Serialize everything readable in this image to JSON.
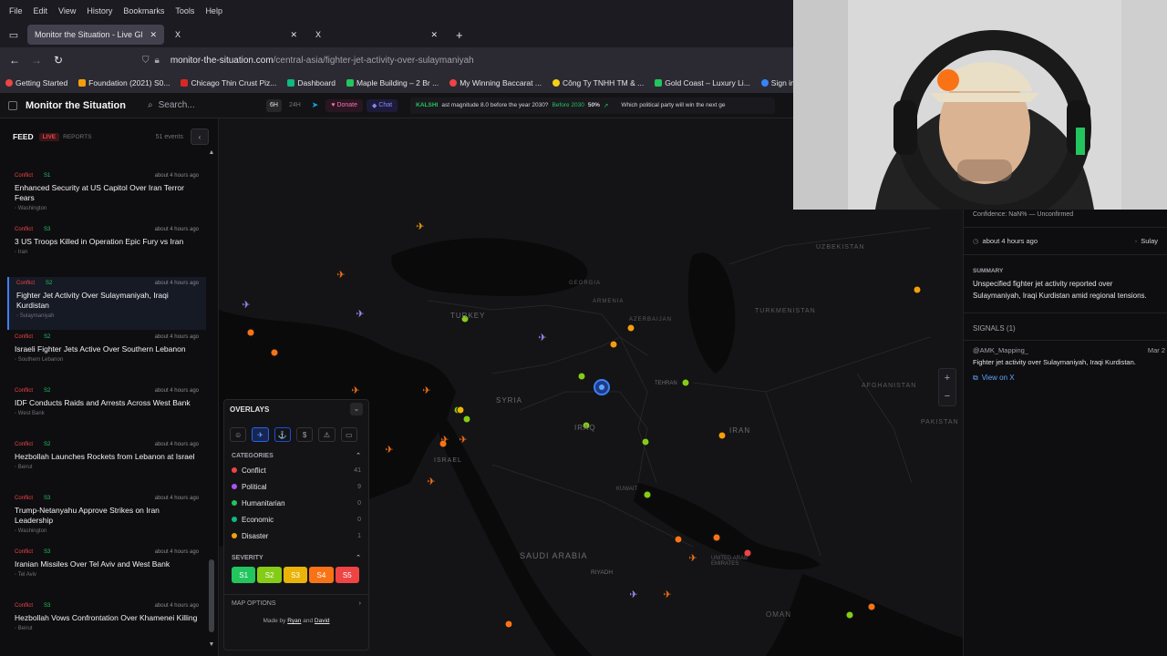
{
  "browser": {
    "menu": [
      "File",
      "Edit",
      "View",
      "History",
      "Bookmarks",
      "Tools",
      "Help"
    ],
    "tabs": [
      {
        "label": "Monitor the Situation - Live Gl"
      },
      {
        "label": "X"
      },
      {
        "label": "X"
      }
    ],
    "url_domain": "monitor-the-situation.com",
    "url_path": "/central-asia/fighter-jet-activity-over-sulaymaniyah",
    "bookmarks": [
      "Getting Started",
      "Foundation (2021) S0...",
      "Chicago Thin Crust Piz...",
      "Dashboard",
      "Maple Building – 2 Br ...",
      "My Winning Baccarat ...",
      "Công Ty TNHH TM & ...",
      "Gold Coast – Luxury Li...",
      "Sign in - Drea"
    ]
  },
  "app": {
    "brand": "Monitor the Situation",
    "search_placeholder": "Search...",
    "range_6h": "6H",
    "range_24h": "24H",
    "donate": "Donate",
    "chat": "Chat",
    "ticker": {
      "source": "KALSHI",
      "q1": "ast magnitude 8.0 before the year 2030?",
      "q1_before": "Before 2030",
      "q1_pct": "50%",
      "q2": "Which political party will win the next ge"
    }
  },
  "feed": {
    "title": "FEED",
    "live": "LIVE",
    "reports": "REPORTS",
    "count": "51 events",
    "items": [
      {
        "cat": "Conflict",
        "sev": "S1",
        "time": "about 4 hours ago",
        "title": "Enhanced Security at US Capitol Over Iran Terror Fears",
        "loc": "Washington"
      },
      {
        "cat": "Conflict",
        "sev": "S3",
        "time": "about 4 hours ago",
        "title": "3 US Troops Killed in Operation Epic Fury vs Iran",
        "loc": "Iran"
      },
      {
        "cat": "Conflict",
        "sev": "S2",
        "time": "about 4 hours ago",
        "title": "Fighter Jet Activity Over Sulaymaniyah, Iraqi Kurdistan",
        "loc": "Sulaymaniyah"
      },
      {
        "cat": "Conflict",
        "sev": "S2",
        "time": "about 4 hours ago",
        "title": "Israeli Fighter Jets Active Over Southern Lebanon",
        "loc": "Southern Lebanon"
      },
      {
        "cat": "Conflict",
        "sev": "S2",
        "time": "about 4 hours ago",
        "title": "IDF Conducts Raids and Arrests Across West Bank",
        "loc": "West Bank"
      },
      {
        "cat": "Conflict",
        "sev": "S2",
        "time": "about 4 hours ago",
        "title": "Hezbollah Launches Rockets from Lebanon at Israel",
        "loc": "Beirut"
      },
      {
        "cat": "Conflict",
        "sev": "S3",
        "time": "about 4 hours ago",
        "title": "Trump-Netanyahu Approve Strikes on Iran Leadership",
        "loc": "Washington"
      },
      {
        "cat": "Conflict",
        "sev": "S3",
        "time": "about 4 hours ago",
        "title": "Iranian Missiles Over Tel Aviv and West Bank",
        "loc": "Tel Aviv"
      },
      {
        "cat": "Conflict",
        "sev": "S3",
        "time": "about 4 hours ago",
        "title": "Hezbollah Vows Confrontation Over Khamenei Killing",
        "loc": "Beirut"
      }
    ]
  },
  "map": {
    "labels": [
      "TURKEY",
      "SYRIA",
      "IRAQ",
      "IRAN",
      "ISRAEL",
      "SAUDI ARABIA",
      "GEORGIA",
      "ARMENIA",
      "AZERBAIJAN",
      "UZBEKISTAN",
      "TURKMENISTAN",
      "AFGHANISTAN",
      "PAKISTAN",
      "KUWAIT",
      "UNITED ARAB EMIRATES",
      "OMAN",
      "TEHRAN",
      "RIYADH"
    ],
    "zoom_in": "+",
    "zoom_out": "−"
  },
  "overlays": {
    "title": "OVERLAYS",
    "categories_title": "CATEGORIES",
    "categories": [
      {
        "name": "Conflict",
        "count": "41",
        "color": "#ef4444"
      },
      {
        "name": "Political",
        "count": "9",
        "color": "#a855f7"
      },
      {
        "name": "Humanitarian",
        "count": "0",
        "color": "#22c55e"
      },
      {
        "name": "Economic",
        "count": "0",
        "color": "#10b981"
      },
      {
        "name": "Disaster",
        "count": "1",
        "color": "#f59e0b"
      }
    ],
    "severity_title": "SEVERITY",
    "severity": [
      {
        "label": "S1",
        "color": "#22c55e"
      },
      {
        "label": "S2",
        "color": "#84cc16"
      },
      {
        "label": "S3",
        "color": "#eab308"
      },
      {
        "label": "S4",
        "color": "#f97316"
      },
      {
        "label": "S5",
        "color": "#ef4444"
      }
    ],
    "map_options": "MAP OPTIONS",
    "made_by": "Made by",
    "author1": "Ryan",
    "and": "and",
    "author2": "David"
  },
  "detail": {
    "confidence": "Confidence:  NaN% — Unconfirmed",
    "time": "about 4 hours ago",
    "loc": "Sulay",
    "summary_title": "SUMMARY",
    "summary": "Unspecified fighter jet activity reported over Sulaymaniyah, Iraqi Kurdistan amid regional tensions.",
    "signals_title": "SIGNALS (1)",
    "signal_user": "@AMK_Mapping_",
    "signal_date": "Mar 2",
    "signal_text": "Fighter jet activity over Sulaymaniyah, Iraqi Kurdistan.",
    "view_on_x": "View on X"
  }
}
